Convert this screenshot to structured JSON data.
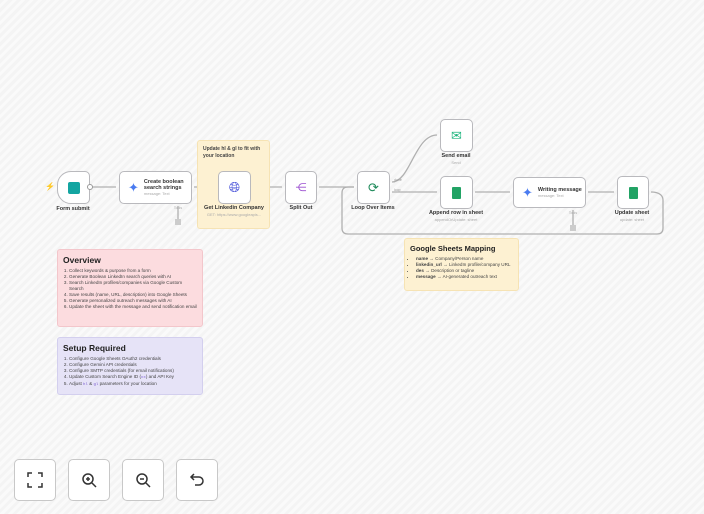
{
  "nodes": {
    "form_submit": {
      "label": "Form submit"
    },
    "create_boolean": {
      "label": "Create boolean search strings",
      "sub": "message: Text",
      "tools": "Tools"
    },
    "get_linkedin": {
      "label": "Get Linkedin Company",
      "sub": "GET: https://www.googleapis..."
    },
    "split_out": {
      "label": "Split Out"
    },
    "loop": {
      "label": "Loop Over Items",
      "done": "done",
      "loop": "loop"
    },
    "send_email": {
      "label": "Send email",
      "sub": "Send"
    },
    "append_row": {
      "label": "Append row in sheet",
      "sub": "appendOrUpdate: sheet"
    },
    "writing_message": {
      "label": "Writing message",
      "sub": "message: Text",
      "tools": "Tools"
    },
    "update_sheet": {
      "label": "Update sheet",
      "sub": "update: sheet"
    }
  },
  "sticky_location": {
    "text": "Update hl & gl to fit with your location"
  },
  "overview": {
    "title": "Overview",
    "items": [
      "Collect keywords & purpose from a form",
      "Generate Boolean LinkedIn search queries with AI",
      "Search LinkedIn profiles/companies via Google Custom Search",
      "Save results (name, URL, description) into Google Sheets",
      "Generate personalized outreach messages with AI",
      "Update the sheet with the message and send notification email"
    ]
  },
  "setup": {
    "title": "Setup Required",
    "items": [
      "Configure Google Sheets OAuth2 credentials",
      "Configure Gemini API credentials",
      "Configure SMTP credentials (for email notifications)"
    ],
    "item4_a": "Update Custom Search Engine ID (",
    "item4_code": "cx",
    "item4_b": ") and API Key",
    "item5_a": "Adjust ",
    "item5_hl": "hl",
    "item5_and": " & ",
    "item5_gl": "gl",
    "item5_b": " parameters for your location"
  },
  "mapping": {
    "title": "Google Sheets Mapping",
    "rows": [
      {
        "key": "name",
        "val": "→ Company/Person name"
      },
      {
        "key": "linkedin_url",
        "val": "→ LinkedIn profile/company URL"
      },
      {
        "key": "des",
        "val": "→ Description or tagline"
      },
      {
        "key": "message",
        "val": "→ AI-generated outreach text"
      }
    ]
  },
  "controls": [
    "fit-view",
    "zoom-in",
    "zoom-out",
    "undo"
  ]
}
